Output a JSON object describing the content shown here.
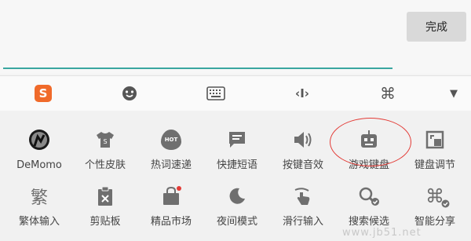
{
  "top": {
    "done_label": "完成"
  },
  "toolbar": {
    "items": [
      {
        "name": "sogou-logo-icon",
        "glyph": "S"
      },
      {
        "name": "emoji-icon"
      },
      {
        "name": "keyboard-icon"
      },
      {
        "name": "cursor-move-icon",
        "glyph": "‹I›"
      },
      {
        "name": "command-icon",
        "glyph": "⌘"
      },
      {
        "name": "collapse-arrow-icon",
        "glyph": "▼"
      }
    ]
  },
  "grid": {
    "row1": [
      {
        "label": "DeMomo",
        "icon": "avatar-icon"
      },
      {
        "label": "个性皮肤",
        "icon": "tshirt-icon"
      },
      {
        "label": "热词速递",
        "icon": "hot-flame-icon",
        "glyph": "HOT"
      },
      {
        "label": "快捷短语",
        "icon": "message-icon"
      },
      {
        "label": "按键音效",
        "icon": "speaker-icon"
      },
      {
        "label": "游戏键盘",
        "icon": "game-controller-icon"
      },
      {
        "label": "键盘调节",
        "icon": "resize-icon"
      }
    ],
    "row2": [
      {
        "label": "繁体输入",
        "icon": "traditional-char-icon",
        "glyph": "繁"
      },
      {
        "label": "剪贴板",
        "icon": "clipboard-icon"
      },
      {
        "label": "精品市场",
        "icon": "shopping-bag-icon"
      },
      {
        "label": "夜间模式",
        "icon": "moon-icon"
      },
      {
        "label": "滑行输入",
        "icon": "swipe-hand-icon"
      },
      {
        "label": "搜索候选",
        "icon": "search-check-icon"
      },
      {
        "label": "智能分享",
        "icon": "share-command-icon",
        "glyph": "⌘"
      }
    ]
  },
  "watermark": "www.jb51.net",
  "colors": {
    "accent_line": "#3aa6a0",
    "annotation": "#e33b36",
    "sogou_orange": "#f06a2a",
    "icon_gray": "#6f6f6f"
  }
}
